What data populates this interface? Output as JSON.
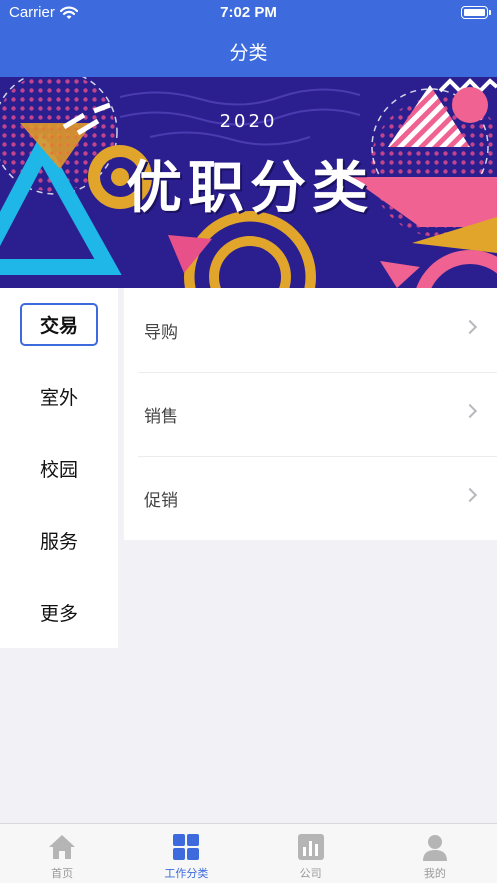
{
  "status_bar": {
    "carrier": "Carrier",
    "time": "7:02 PM"
  },
  "nav": {
    "title": "分类"
  },
  "banner": {
    "year": "2020",
    "title": "优职分类"
  },
  "sidebar": {
    "items": [
      {
        "label": "交易",
        "active": true
      },
      {
        "label": "室外"
      },
      {
        "label": "校园"
      },
      {
        "label": "服务"
      },
      {
        "label": "更多"
      }
    ]
  },
  "content": {
    "rows": [
      {
        "label": "导购"
      },
      {
        "label": "销售"
      },
      {
        "label": "促销"
      }
    ]
  },
  "tabbar": {
    "tabs": [
      {
        "label": "首页",
        "icon": "home-icon"
      },
      {
        "label": "工作分类",
        "icon": "grid-icon",
        "active": true
      },
      {
        "label": "公司",
        "icon": "bar-chart-icon"
      },
      {
        "label": "我的",
        "icon": "user-icon"
      }
    ]
  },
  "colors": {
    "primary": "#3d6bdd",
    "banner_bg": "#2b1f8f",
    "inactive": "#9a9a9a"
  }
}
